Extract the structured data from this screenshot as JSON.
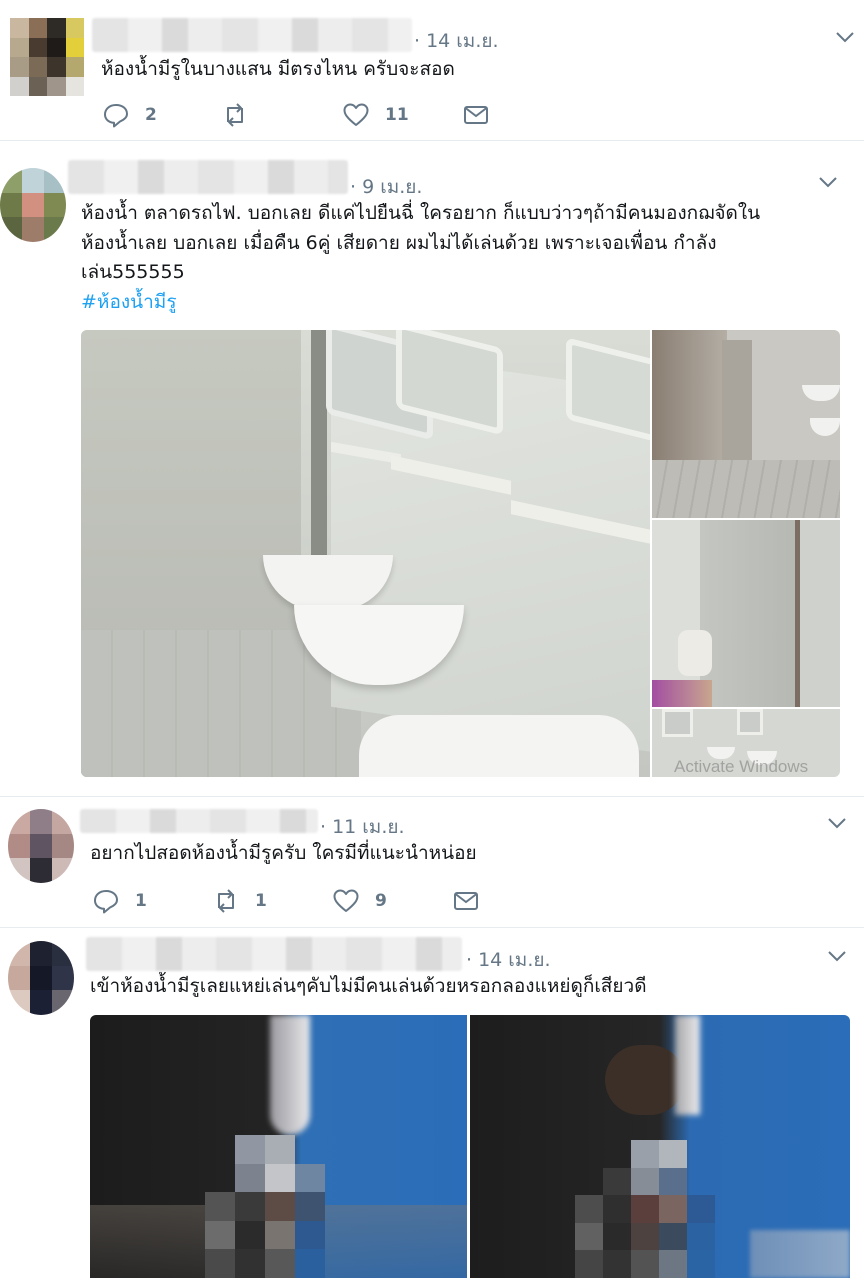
{
  "tweets": [
    {
      "date": "· 14 เม.ย.",
      "lines": [
        "ห้องน้ำมีรูในบางแสน มีตรงไหน ครับจะสอด"
      ],
      "actions": {
        "reply": "2",
        "retweet": "",
        "like": "11"
      }
    },
    {
      "date": "· 9 เม.ย.",
      "lines": [
        "ห้องน้ำ ตลาดรถไฟ. บอกเลย ดีแค่ไปยืนฉี่ ใครอยาก ก็แบบว่าวๆถ้ามีคนมองกฌจัดใน",
        "ห้องน้ำเลย  บอกเลย เมื่อคืน 6คู่ เสียดาย ผมไม่ได้เล่นด้วย เพราะเจอเพื่อน กำลัง",
        "เล่น555555"
      ],
      "hashtag": "#ห้องน้ำมีรู",
      "watermark": "Activate Windows"
    },
    {
      "date": "· 11 เม.ย.",
      "lines": [
        "อยากไปสอดห้องน้ำมีรูครับ ใครมีที่แนะนำหน่อย"
      ],
      "actions": {
        "reply": "1",
        "retweet": "1",
        "like": "9"
      }
    },
    {
      "date": "· 14 เม.ย.",
      "lines": [
        "เข้าห้องน้ำมีรูเลยแหย่เล่นๆคับไม่มีคนเล่นด้วยหรอกลองแหย่ดูก็เสียวดี"
      ]
    }
  ],
  "icons": {
    "reply": "reply-icon",
    "retweet": "retweet-icon",
    "like": "heart-icon",
    "dm": "envelope-icon",
    "more": "chevron-down-icon"
  },
  "colors": {
    "text": "#14171a",
    "muted": "#657786",
    "link": "#1da1f2",
    "divider": "#e6ecf0"
  }
}
